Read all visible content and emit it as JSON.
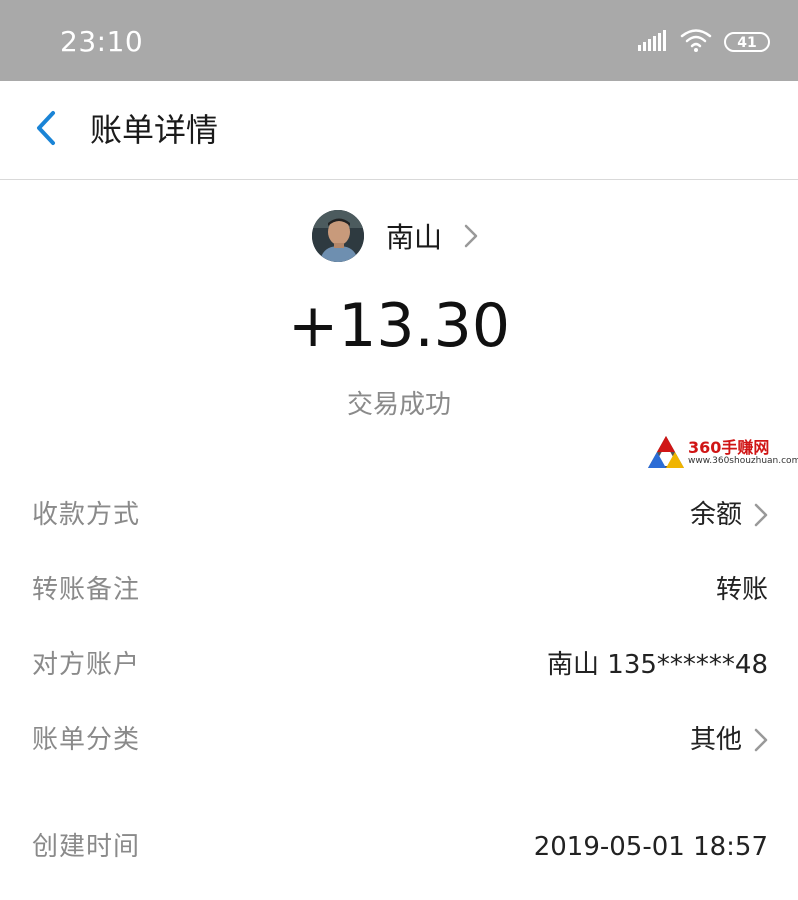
{
  "status_bar": {
    "time": "23:10",
    "battery": "41"
  },
  "header": {
    "title": "账单详情"
  },
  "payee": {
    "name": "南山"
  },
  "transaction": {
    "amount": "+13.30",
    "status": "交易成功"
  },
  "watermark": {
    "text": "360手赚网",
    "url": "www.360shouzhuan.com"
  },
  "details": [
    {
      "label": "收款方式",
      "value": "余额"
    },
    {
      "label": "转账备注",
      "value": "转账"
    },
    {
      "label": "对方账户",
      "value": "南山 135******48"
    },
    {
      "label": "账单分类",
      "value": "其他"
    },
    {
      "label": "创建时间",
      "value": "2019-05-01 18:57"
    }
  ],
  "colors": {
    "accent": "#1a84d6",
    "status_bar": "#a9a9a9"
  },
  "icons": {
    "back": "chevron-left-icon",
    "forward": "chevron-right-icon",
    "signal": "signal-icon",
    "wifi": "wifi-icon",
    "battery": "battery-icon"
  }
}
